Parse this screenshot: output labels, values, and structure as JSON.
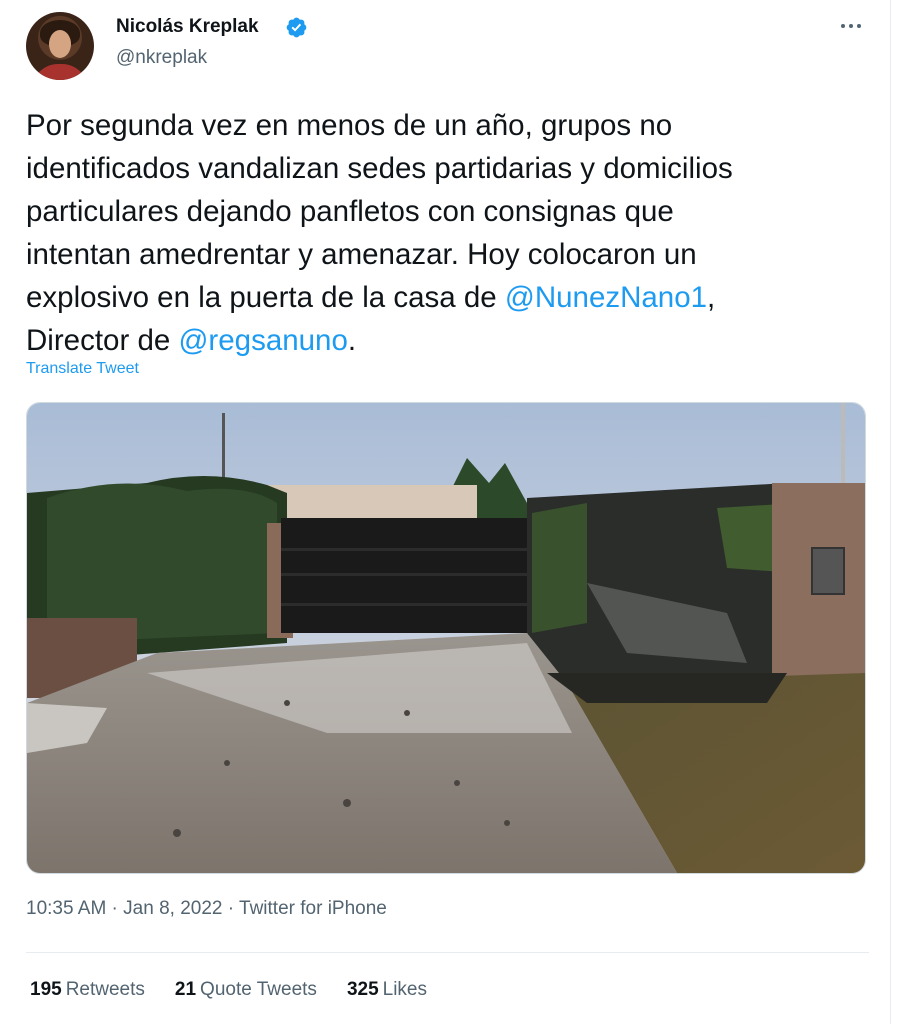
{
  "author": {
    "name": "Nicolás Kreplak",
    "handle": "@nkreplak",
    "verified": true
  },
  "more_label": "More",
  "tweet": {
    "line1": "Por segunda vez en menos de un año, grupos no",
    "line2": "identificados vandalizan sedes partidarias y domicilios",
    "line3": "particulares dejando panfletos con consignas que",
    "line4": "intentan amedrentar y amenazar. Hoy colocaron un",
    "line5_pre": "explosivo en la puerta de la casa de ",
    "mention1": "@NunezNano1",
    "line5_post": ",",
    "line6_pre": "Director de ",
    "mention2": "@regsanuno",
    "line6_post": "."
  },
  "translate_label": "Translate Tweet",
  "meta": "10:35 AM · Jan 8, 2022 · Twitter for iPhone",
  "stats": {
    "retweets_count": "195",
    "retweets_label": "Retweets",
    "quotes_count": "21",
    "quotes_label": "Quote Tweets",
    "likes_count": "325",
    "likes_label": "Likes"
  },
  "colors": {
    "accent": "#1d9bf0",
    "secondary_text": "#536471",
    "primary_text": "#0f1419"
  }
}
